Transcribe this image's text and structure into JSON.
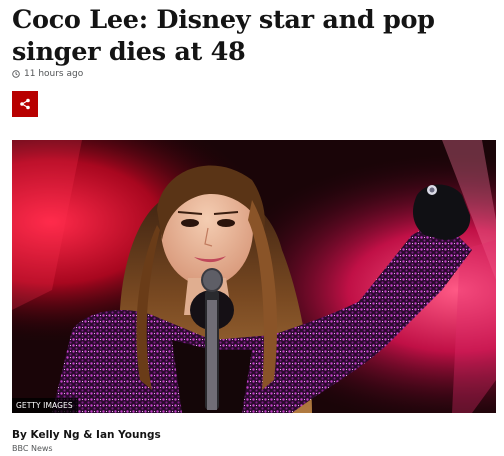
{
  "article": {
    "headline": "Coco Lee: Disney star and pop singer dies at 48",
    "timestamp": "11 hours ago",
    "share_label": "Share",
    "image_credit": "GETTY IMAGES",
    "byline": "By Kelly Ng & Ian Youngs",
    "organization": "BBC News"
  },
  "icons": {
    "timestamp": "clock-icon",
    "share": "share-icon"
  },
  "colors": {
    "share_button": "#b80000",
    "headline": "#141414",
    "meta_text": "#545658"
  }
}
